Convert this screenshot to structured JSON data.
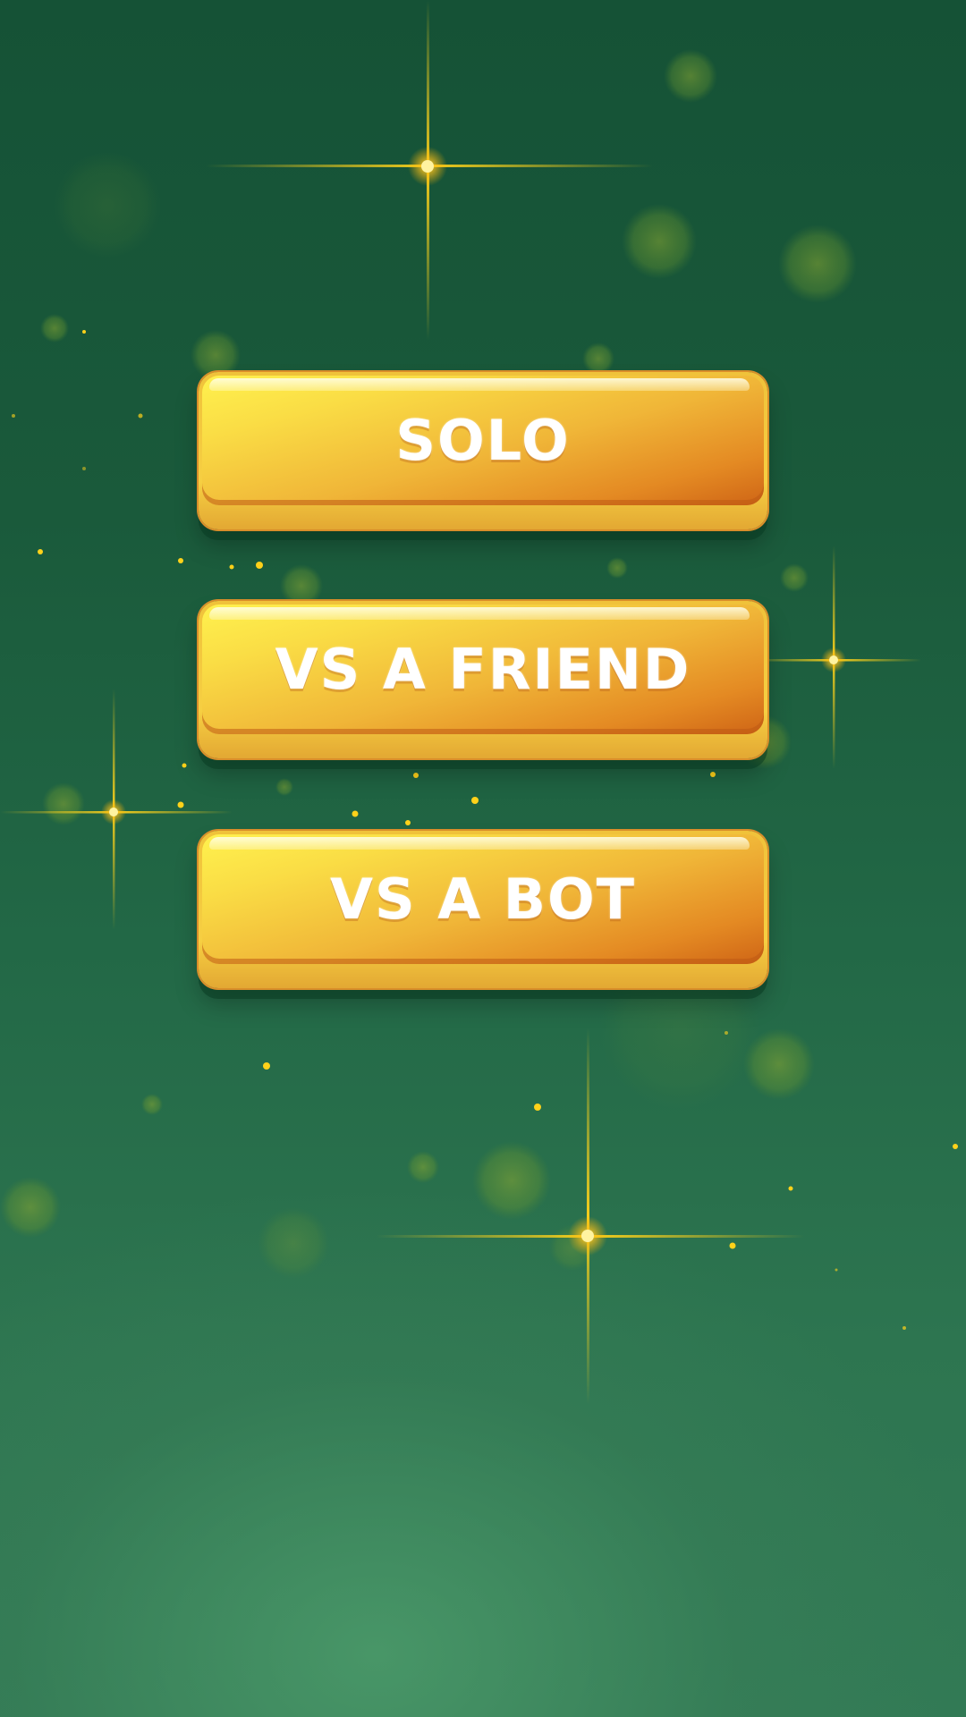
{
  "menu": {
    "buttons": [
      {
        "label": "SOLO"
      },
      {
        "label": "VS A FRIEND"
      },
      {
        "label": "VS A BOT"
      }
    ]
  },
  "theme": {
    "background_top": "#155236",
    "background_bottom": "#327a55",
    "button_gold": "#fadd45",
    "button_orange": "#cf6516",
    "sparkle": "#ffd21a"
  }
}
